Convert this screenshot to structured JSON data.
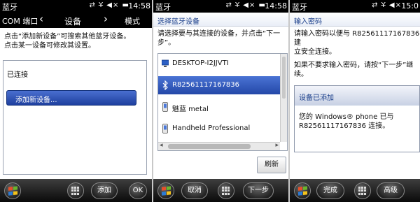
{
  "panel1": {
    "status": {
      "app": "蓝牙",
      "time": "14:58"
    },
    "tabs": {
      "left_label": "COM 端口",
      "prev_arrow": "‹",
      "center_label": "设备",
      "next_arrow": "›",
      "right_label": "模式"
    },
    "instruction": [
      "点击“添加新设备”可搜索其他蓝牙设备。",
      "点击某一设备可修改其设置。"
    ],
    "section_label": "已连接",
    "add_device_label": "添加新设备...",
    "softkeys": {
      "add": "添加",
      "ok": "OK"
    }
  },
  "panel2": {
    "status": {
      "app": "蓝牙",
      "time": "14:58"
    },
    "title": "选择蓝牙设备",
    "instruction": [
      "请选择要与其连接的设备，并点击“下一",
      "步”。"
    ],
    "devices": [
      {
        "name": "DESKTOP-I2JJVTI",
        "icon": "computer-icon"
      },
      {
        "name": "R82561117167836",
        "icon": "bluetooth-icon"
      },
      {
        "name": "魅蓝 metal",
        "icon": "phone-icon"
      },
      {
        "name": "Handheld Professional",
        "icon": "phone-icon"
      }
    ],
    "selected_index": 1,
    "refresh_label": "刷新",
    "softkeys": {
      "cancel": "取消",
      "next": "下一步"
    }
  },
  "panel3": {
    "status": {
      "app": "蓝牙",
      "time": "15:0"
    },
    "title": "输入密码",
    "instruction": [
      "请输入密码以便与 R82561117167836 建",
      "立安全连接。",
      "",
      "如果不要求输入密码，请按“下一步”继",
      "续。"
    ],
    "dialog": {
      "title": "设备已添加",
      "message": [
        "您的 Windows® phone 已与",
        "R82561117167836 连接。"
      ]
    },
    "softkeys": {
      "done": "完成",
      "advanced": "高级"
    }
  },
  "colors": {
    "selection": "#2a4fae",
    "title_text": "#1b3f8b",
    "bar": "#000000"
  }
}
